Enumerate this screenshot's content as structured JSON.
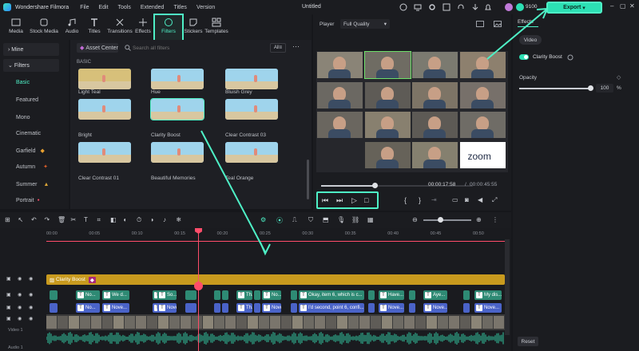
{
  "app": {
    "name": "Wondershare Filmora",
    "doc_title": "Untitled",
    "credits": "9100",
    "export_label": "Export"
  },
  "menu": [
    "File",
    "Edit",
    "Tools",
    "Extended",
    "Titles",
    "Version"
  ],
  "toolbar": [
    "Media",
    "Stock Media",
    "Audio",
    "Titles",
    "Transitions",
    "Effects",
    "Filters",
    "Stickers",
    "Templates"
  ],
  "sidebar": {
    "group_mine": "Mine",
    "group_filters": "Filters",
    "items": [
      "Basic",
      "Featured",
      "Mono",
      "Cinematic",
      "Garfield",
      "Autumn",
      "Summer",
      "Portrait"
    ]
  },
  "library": {
    "asset_center": "Asset Center",
    "search_placeholder": "Search all filters",
    "all_label": "All",
    "section": "BASIC",
    "filters": [
      "Light Teal",
      "Hue",
      "Bluish Grey",
      "Bright",
      "Clarity Boost",
      "Clear Contrast 03",
      "Clear Contrast 01",
      "Beautiful Memories",
      "Teal Orange"
    ]
  },
  "player": {
    "label": "Player",
    "quality": "Full Quality",
    "current_time": "00:00:17:58",
    "total_time": "00:00:45:55",
    "progress": 0.35,
    "zoom_logo": "zoom"
  },
  "properties": {
    "tab_effects": "Effects",
    "tab_video": "Video",
    "effect_name": "Clarity Boost",
    "opacity_label": "Opacity",
    "opacity_value": "100",
    "opacity_unit": "%",
    "reset_label": "Reset"
  },
  "timeline": {
    "ticks": [
      "00:00",
      "00:05",
      "00:10",
      "00:15",
      "00:20",
      "00:25",
      "00:30",
      "00:35",
      "00:40",
      "00:45",
      "00:50"
    ],
    "filter_clip": "Clarity Boost",
    "track_video_label": "Video 1",
    "track_audio_label": "Audio 1",
    "text_row1": [
      "No...",
      "We d...",
      "Do...",
      "So...",
      "Th...",
      "No...",
      "Okay, item 6, which is c...",
      "Have...",
      "Aye...",
      "My dis..."
    ],
    "text_row2": [
      "No...",
      "Nove...",
      "Do...",
      "Nove...",
      "Th...",
      "Nove...",
      "I'd second, point 6, confi...",
      "Nove...",
      "Nove...",
      "Nove..."
    ]
  },
  "colors": {
    "accent": "#2ce0b4",
    "highlight": "#4ef0c6",
    "playhead": "#ff4d6a",
    "filter_track": "#c89a1e"
  }
}
